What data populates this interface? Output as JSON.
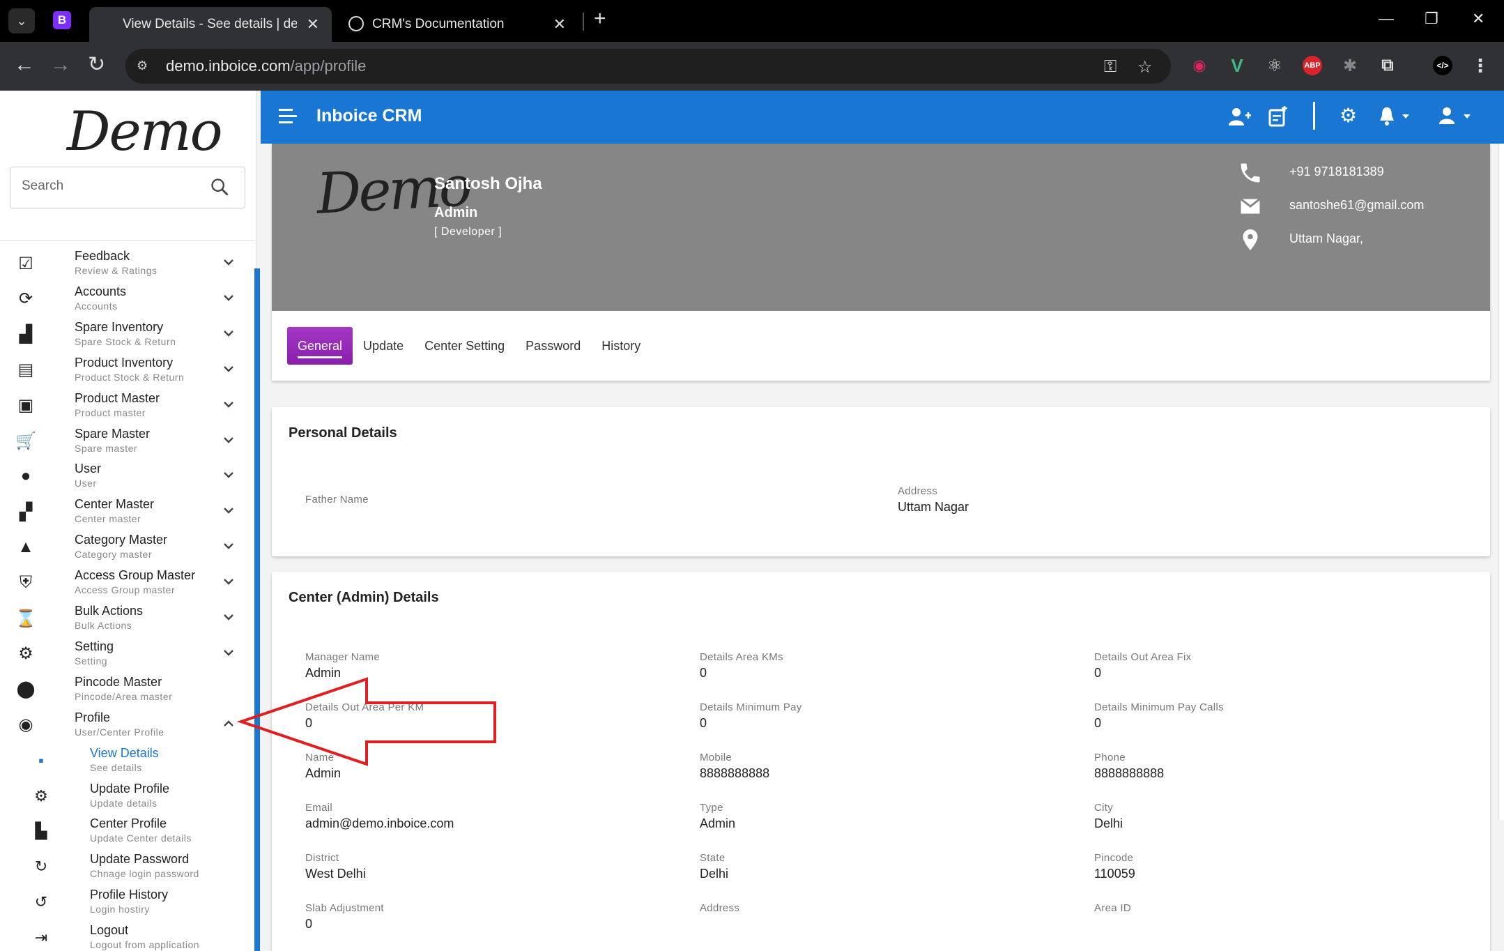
{
  "browser": {
    "tabs": [
      {
        "title": "View Details - See details | demo",
        "active": true
      },
      {
        "title": "CRM's Documentation",
        "active": false
      }
    ],
    "url_domain": "demo.inboice.com",
    "url_path": "/app/profile",
    "profile_initial": "B",
    "extensions": [
      {
        "name": "record-icon",
        "color": "#e0245e",
        "glyph": "▶"
      },
      {
        "name": "vue-devtools-icon",
        "color": "#41b883",
        "glyph": "V"
      },
      {
        "name": "react-devtools-icon",
        "color": "#61dafb",
        "glyph": "⚛"
      },
      {
        "name": "adblock-icon",
        "color": "#d9242b",
        "glyph": "ABP"
      },
      {
        "name": "bug-icon",
        "color": "#777777",
        "glyph": "✱"
      },
      {
        "name": "extensions-puzzle-icon",
        "color": "#dddddd",
        "glyph": "⧉"
      }
    ]
  },
  "app": {
    "title": "Inboice CRM",
    "brand_color": "#1976d2",
    "logo_text": "Demo"
  },
  "sidebar": {
    "search_placeholder": "Search",
    "items": [
      {
        "label": "Feedback",
        "sub": "Review & Ratings",
        "icon": "feedback-icon",
        "glyph": "☑"
      },
      {
        "label": "Accounts",
        "sub": "Accounts",
        "icon": "accounts-icon",
        "glyph": "⟳"
      },
      {
        "label": "Spare Inventory",
        "sub": "Spare Stock & Return",
        "icon": "spare-inventory-icon",
        "glyph": "▟"
      },
      {
        "label": "Product Inventory",
        "sub": "Product Stock & Return",
        "icon": "product-inventory-icon",
        "glyph": "▤"
      },
      {
        "label": "Product Master",
        "sub": "Product master",
        "icon": "product-master-icon",
        "glyph": "▣"
      },
      {
        "label": "Spare Master",
        "sub": "Spare master",
        "icon": "cart-icon",
        "glyph": "🛒"
      },
      {
        "label": "User",
        "sub": "User",
        "icon": "user-icon",
        "glyph": "●"
      },
      {
        "label": "Center Master",
        "sub": "Center master",
        "icon": "center-icon",
        "glyph": "▞"
      },
      {
        "label": "Category Master",
        "sub": "Category master",
        "icon": "category-icon",
        "glyph": "▲"
      },
      {
        "label": "Access Group Master",
        "sub": "Access Group master",
        "icon": "access-group-icon",
        "glyph": "⛨"
      },
      {
        "label": "Bulk Actions",
        "sub": "Bulk Actions",
        "icon": "bulk-actions-icon",
        "glyph": "⌛"
      },
      {
        "label": "Setting",
        "sub": "Setting",
        "icon": "setting-icon",
        "glyph": "⚙"
      },
      {
        "label": "Pincode Master",
        "sub": "Pincode/Area master",
        "icon": "pincode-icon",
        "glyph": "⬤"
      },
      {
        "label": "Profile",
        "sub": "User/Center Profile",
        "icon": "profile-icon",
        "glyph": "◉"
      }
    ],
    "submenu": [
      {
        "label": "View Details",
        "sub": "See details",
        "icon": "view-details-icon",
        "glyph": "▪",
        "active": true
      },
      {
        "label": "Update Profile",
        "sub": "Update details",
        "icon": "update-profile-icon",
        "glyph": "⚙"
      },
      {
        "label": "Center Profile",
        "sub": "Update Center details",
        "icon": "center-profile-icon",
        "glyph": "▙"
      },
      {
        "label": "Update Password",
        "sub": "Chnage login password",
        "icon": "password-icon",
        "glyph": "↻"
      },
      {
        "label": "Profile History",
        "sub": "Login hostiry",
        "icon": "history-icon",
        "glyph": "↺"
      },
      {
        "label": "Logout",
        "sub": "Logout from application",
        "icon": "logout-icon",
        "glyph": "⇥"
      }
    ]
  },
  "profile": {
    "name": "Santosh Ojha",
    "role": "Admin",
    "designation": "[ Developer ]",
    "phone": "+91 9718181389",
    "email": "santoshe61@gmail.com",
    "location": "Uttam Nagar,",
    "tabs": [
      "General",
      "Update",
      "Center Setting",
      "Password",
      "History"
    ]
  },
  "personal_details": {
    "title": "Personal Details",
    "father_name_label": "Father Name",
    "father_name": "",
    "address_label": "Address",
    "address": "Uttam Nagar"
  },
  "center_details": {
    "title": "Center (Admin) Details",
    "fields": [
      {
        "label": "Manager Name",
        "value": "Admin"
      },
      {
        "label": "Details Area KMs",
        "value": "0"
      },
      {
        "label": "Details Out Area Fix",
        "value": "0"
      },
      {
        "label": "Details Out Area Per KM",
        "value": "0"
      },
      {
        "label": "Details Minimum Pay",
        "value": "0"
      },
      {
        "label": "Details Minimum Pay Calls",
        "value": "0"
      },
      {
        "label": "Name",
        "value": "Admin"
      },
      {
        "label": "Mobile",
        "value": "8888888888"
      },
      {
        "label": "Phone",
        "value": "8888888888"
      },
      {
        "label": "Email",
        "value": "admin@demo.inboice.com"
      },
      {
        "label": "Type",
        "value": "Admin"
      },
      {
        "label": "City",
        "value": "Delhi"
      },
      {
        "label": "District",
        "value": "West Delhi"
      },
      {
        "label": "State",
        "value": "Delhi"
      },
      {
        "label": "Pincode",
        "value": "110059"
      },
      {
        "label": "Slab Adjustment",
        "value": "0"
      },
      {
        "label": "Address",
        "value": ""
      },
      {
        "label": "Area ID",
        "value": ""
      }
    ]
  },
  "annotation": {
    "color": "#e02020"
  }
}
